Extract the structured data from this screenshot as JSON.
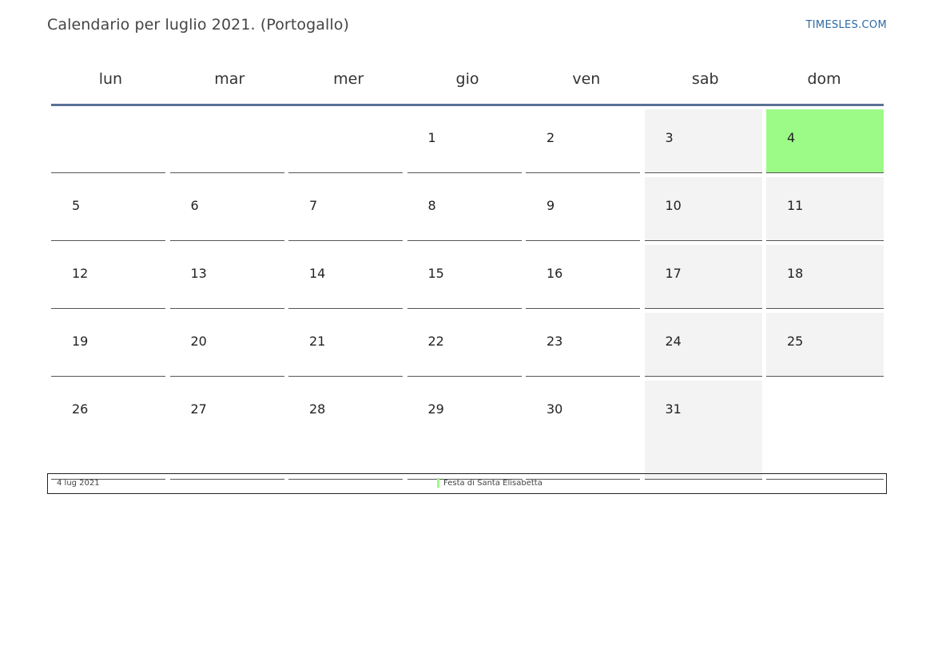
{
  "header": {
    "title": "Calendario per luglio 2021. (Portogallo)",
    "brand": "TIMESLES.COM"
  },
  "calendar": {
    "weekdays": [
      "lun",
      "mar",
      "mer",
      "gio",
      "ven",
      "sab",
      "dom"
    ],
    "weeks": [
      [
        "",
        "",
        "",
        "1",
        "2",
        "3",
        "4"
      ],
      [
        "5",
        "6",
        "7",
        "8",
        "9",
        "10",
        "11"
      ],
      [
        "12",
        "13",
        "14",
        "15",
        "16",
        "17",
        "18"
      ],
      [
        "19",
        "20",
        "21",
        "22",
        "23",
        "24",
        "25"
      ],
      [
        "26",
        "27",
        "28",
        "29",
        "30",
        "31",
        ""
      ]
    ],
    "holiday_day": "4"
  },
  "legend": {
    "date": "4 lug 2021",
    "holiday": "Festa di Santa Elisabetta",
    "holiday_color": "#9cfb87"
  },
  "colors": {
    "header_rule": "#5a7196",
    "weekend_shade": "#f3f3f3",
    "brand": "#2d6aa3"
  }
}
